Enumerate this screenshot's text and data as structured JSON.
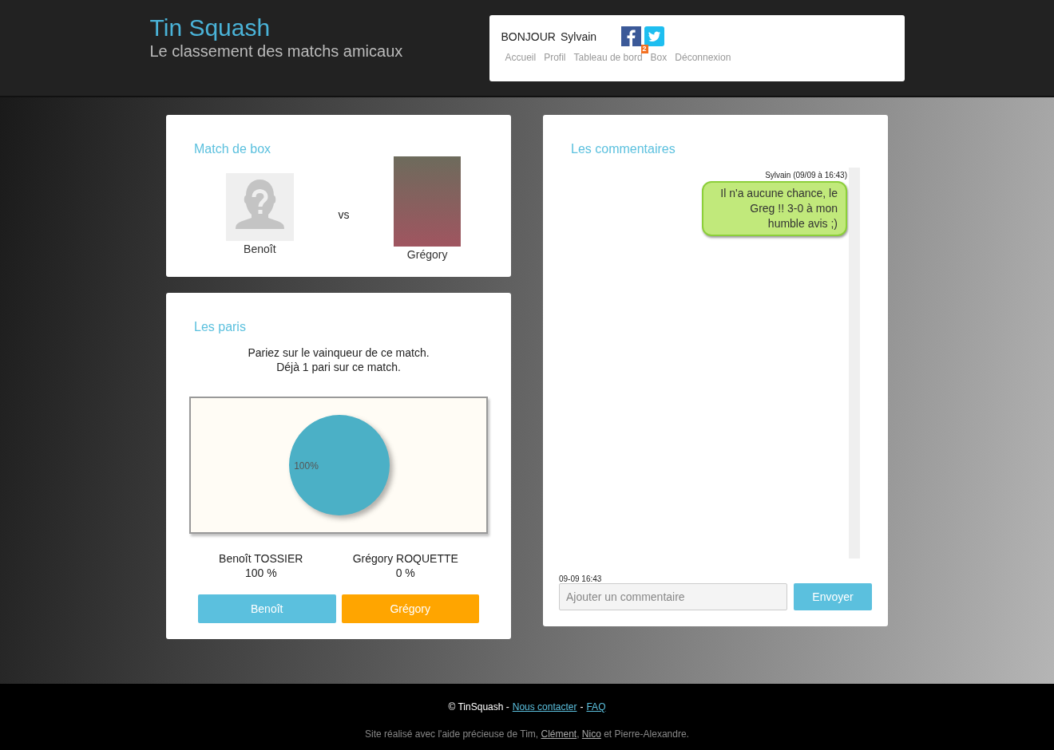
{
  "header": {
    "title": "Tin Squash",
    "subtitle": "Le classement des matchs amicaux",
    "greeting": "BONJOUR",
    "user": "Sylvain",
    "nav": [
      {
        "label": "Accueil"
      },
      {
        "label": "Profil"
      },
      {
        "label": "Tableau de bord",
        "badge": "2"
      },
      {
        "label": "Box"
      },
      {
        "label": "Déconnexion"
      }
    ]
  },
  "match": {
    "title": "Match de box",
    "vs": "vs",
    "players": [
      {
        "name": "Benoît",
        "photo": false
      },
      {
        "name": "Grégory",
        "photo": true
      }
    ]
  },
  "bets": {
    "title": "Les paris",
    "intro": [
      "Pariez sur le vainqueur de ce match.",
      "Déjà 1 pari sur ce match."
    ],
    "chart_data": {
      "type": "pie",
      "series": [
        {
          "color": "#4bb0c6",
          "values": [
            100
          ]
        }
      ],
      "value_labels": [
        "100%"
      ]
    },
    "results": [
      {
        "name": "Benoît TOSSIER",
        "share": "100 %"
      },
      {
        "name": "Grégory ROQUETTE",
        "share": "0 %"
      }
    ],
    "buttons": [
      {
        "label": "Benoît",
        "color": "#5bc0de"
      },
      {
        "label": "Grégory",
        "color": "#ffa500"
      }
    ]
  },
  "comments": {
    "title": "Les commentaires",
    "messages": [
      {
        "author": "Sylvain (09/09 à 16:43)",
        "text": "Il n'a aucune chance, le Greg !! 3-0 à mon humble avis ;)"
      }
    ],
    "timestamp": "09-09 16:43",
    "input": {
      "placeholder": "Ajouter un commentaire"
    },
    "send": "Envoyer"
  },
  "footer": {
    "copyright": "© TinSquash -",
    "links": [
      "Nous contacter",
      "FAQ"
    ],
    "separator": "-",
    "credits": [
      {
        "kind": "text",
        "text": "Site réalisé avec l'aide précieuse de Tim, "
      },
      {
        "kind": "link",
        "text": "Clément"
      },
      {
        "kind": "text",
        "text": ", "
      },
      {
        "kind": "link",
        "text": "Nico"
      },
      {
        "kind": "text",
        "text": " et Pierre-Alexandre."
      }
    ]
  }
}
